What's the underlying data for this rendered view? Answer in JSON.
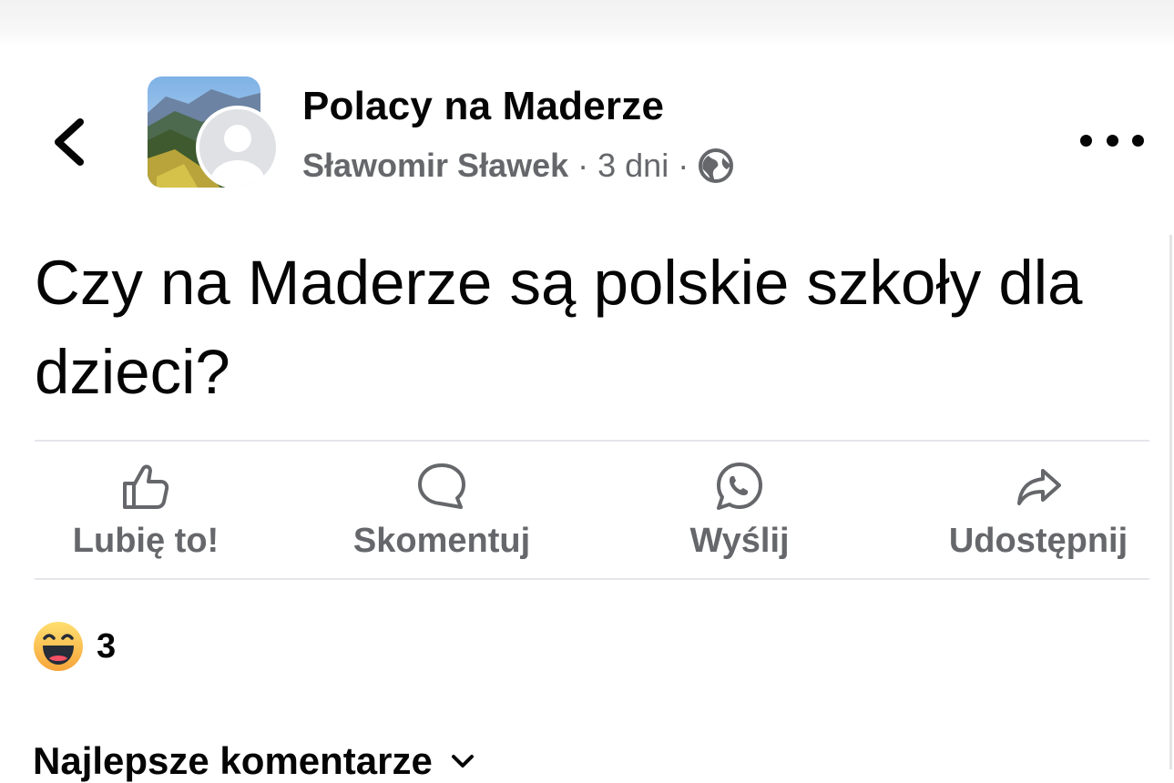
{
  "header": {
    "group_name": "Polacy na Maderze",
    "author": "Sławomir Sławek",
    "separator": "·",
    "time": "3 dni",
    "privacy_icon": "globe-icon",
    "back_icon": "chevron-left-icon",
    "more_icon": "more-horizontal-icon"
  },
  "post": {
    "text": "Czy na Maderze są polskie szkoły dla dzieci?"
  },
  "actions": [
    {
      "label": "Lubię to!",
      "icon": "thumbs-up-icon"
    },
    {
      "label": "Skomentuj",
      "icon": "comment-icon"
    },
    {
      "label": "Wyślij",
      "icon": "whatsapp-icon"
    },
    {
      "label": "Udostępnij",
      "icon": "share-icon"
    }
  ],
  "reactions": {
    "icon": "haha-reaction-icon",
    "count": "3"
  },
  "comments": {
    "sort_label": "Najlepsze komentarze"
  },
  "colors": {
    "text_primary": "#050505",
    "text_secondary": "#65676b",
    "divider": "#e4e6eb",
    "haha_yellow": "#f7b125"
  }
}
